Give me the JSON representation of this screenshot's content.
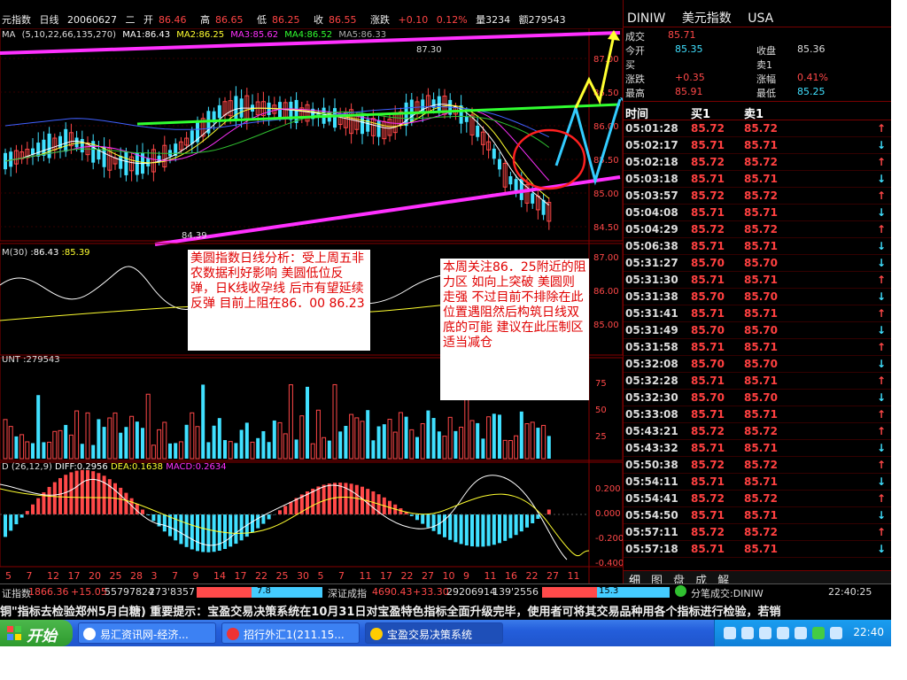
{
  "top": {
    "title": "元指数",
    "period": "日线",
    "date": "20060627",
    "weekday": "二",
    "open_label": "开",
    "open": "86.46",
    "high_label": "高",
    "high": "86.65",
    "low_label": "低",
    "low": "86.25",
    "close_label": "收",
    "close": "86.55",
    "change_label": "涨跌",
    "change": "+0.10",
    "pct": "0.12%",
    "vol": "量3234",
    "amt": "额279543"
  },
  "ma_bar": {
    "label": "MA",
    "params": "(5,10,22,66,135,270)",
    "ma1": "MA1:86.43",
    "ma2": "MA2:86.25",
    "ma3": "MA3:85.62",
    "ma4": "MA4:86.52",
    "ma5": "MA5:86.33"
  },
  "price_axis": [
    "87.00",
    "86.50",
    "86.00",
    "85.50",
    "85.00",
    "84.50"
  ],
  "hi_mark": "87.30",
  "lo_mark": "84.39",
  "dmi": {
    "label": "M",
    "params": "(30)",
    "v1": ":86.43",
    "v2": ":85.39"
  },
  "dmi_axis": [
    "87.00",
    "86.00",
    "85.00"
  ],
  "vol": {
    "label": "UNT",
    "v": "279543"
  },
  "vol_axis": [
    "75",
    "50",
    "25"
  ],
  "macd": {
    "label": "D",
    "params": "(26,12,9)",
    "diff": "DIFF:0.2956",
    "dea": "DEA:0.1638",
    "macd": "MACD:0.2634"
  },
  "macd_axis": [
    "0.200",
    "0.000",
    "-0.200",
    "-0.400"
  ],
  "x_dates": [
    "5",
    "7",
    "12",
    "17",
    "20",
    "25",
    "28",
    "3",
    "7",
    "9",
    "14",
    "17",
    "22",
    "25",
    "30",
    "5",
    "7",
    "11",
    "17",
    "22",
    "27",
    "10",
    "9",
    "11",
    "16",
    "22",
    "27",
    "11"
  ],
  "notes": {
    "left": "美圆指数日线分析：受上周五非农数据利好影响 美圆低位反弹，日K线收孕线 后市有望延续反弹  目前上阻在86．00    86.23",
    "right": "本周关注86．25附近的阻力区 如向上突破 美圆则走强 不过目前不排除在此位置遇阻然后构筑日线双底的可能 建议在此压制区适当减仓"
  },
  "right_panel": {
    "code": "DINIW",
    "name": "美元指数",
    "market": "USA",
    "stats": {
      "deal_label": "成交",
      "deal": "85.71",
      "open_label": "今开",
      "open": "85.35",
      "close_label": "收盘",
      "close": "85.36",
      "buy_label": "买",
      "sell_label": "卖1",
      "chg_label": "涨跌",
      "chg": "+0.35",
      "pct_label": "涨幅",
      "pct": "0.41%",
      "high_label": "最高",
      "high": "85.91",
      "low_label": "最低",
      "low": "85.25"
    },
    "head": {
      "time": "时间",
      "buy": "买1",
      "sell": "卖1"
    },
    "ticks": [
      {
        "t": "05:01:28",
        "b": "85.72",
        "s": "85.72",
        "d": "up"
      },
      {
        "t": "05:02:17",
        "b": "85.71",
        "s": "85.71",
        "d": "down"
      },
      {
        "t": "05:02:18",
        "b": "85.72",
        "s": "85.72",
        "d": "up"
      },
      {
        "t": "05:03:18",
        "b": "85.71",
        "s": "85.71",
        "d": "down"
      },
      {
        "t": "05:03:57",
        "b": "85.72",
        "s": "85.72",
        "d": "up"
      },
      {
        "t": "05:04:08",
        "b": "85.71",
        "s": "85.71",
        "d": "down"
      },
      {
        "t": "05:04:29",
        "b": "85.72",
        "s": "85.72",
        "d": "up"
      },
      {
        "t": "05:06:38",
        "b": "85.71",
        "s": "85.71",
        "d": "down"
      },
      {
        "t": "05:31:27",
        "b": "85.70",
        "s": "85.70",
        "d": "down"
      },
      {
        "t": "05:31:30",
        "b": "85.71",
        "s": "85.71",
        "d": "up"
      },
      {
        "t": "05:31:38",
        "b": "85.70",
        "s": "85.70",
        "d": "down"
      },
      {
        "t": "05:31:41",
        "b": "85.71",
        "s": "85.71",
        "d": "up"
      },
      {
        "t": "05:31:49",
        "b": "85.70",
        "s": "85.70",
        "d": "down"
      },
      {
        "t": "05:31:58",
        "b": "85.71",
        "s": "85.71",
        "d": "up"
      },
      {
        "t": "05:32:08",
        "b": "85.70",
        "s": "85.70",
        "d": "down"
      },
      {
        "t": "05:32:28",
        "b": "85.71",
        "s": "85.71",
        "d": "up"
      },
      {
        "t": "05:32:30",
        "b": "85.70",
        "s": "85.70",
        "d": "down"
      },
      {
        "t": "05:33:08",
        "b": "85.71",
        "s": "85.71",
        "d": "up"
      },
      {
        "t": "05:43:21",
        "b": "85.72",
        "s": "85.72",
        "d": "up"
      },
      {
        "t": "05:43:32",
        "b": "85.71",
        "s": "85.71",
        "d": "down"
      },
      {
        "t": "05:50:38",
        "b": "85.72",
        "s": "85.72",
        "d": "up"
      },
      {
        "t": "05:54:11",
        "b": "85.71",
        "s": "85.71",
        "d": "down"
      },
      {
        "t": "05:54:41",
        "b": "85.72",
        "s": "85.72",
        "d": "up"
      },
      {
        "t": "05:54:50",
        "b": "85.71",
        "s": "85.71",
        "d": "down"
      },
      {
        "t": "05:57:11",
        "b": "85.72",
        "s": "85.72",
        "d": "up"
      },
      {
        "t": "05:57:18",
        "b": "85.71",
        "s": "85.71",
        "d": "down"
      }
    ],
    "tabs": [
      "细",
      "图",
      "盘",
      "成",
      "解"
    ]
  },
  "status": {
    "sh_label": "证指数",
    "sh_val": "1866.36",
    "sh_chg": "+15.05",
    "sh_vol": "55797824",
    "sh_amt": "273'8357",
    "sh_bar": "7.8",
    "sz_label": "深证成指",
    "sz_val": "4690.43",
    "sz_chg": "+33.30",
    "sz_vol": "29206914",
    "sz_amt": "139'2556",
    "sz_bar": "15.3",
    "deal_label": "分笔成交:DINIW",
    "time": "22:40:25"
  },
  "ticker": "铜\"指标去检验郑州5月白糖)    重要提示：宝盈交易决策系统在10月31日对宝盈特色指标全面升级完毕，使用者可将其交易品种用各个指标进行检验，若销",
  "taskbar": {
    "start": "开始",
    "tasks": [
      "易汇资讯网-经济...",
      "招行外汇1(211.15...",
      "宝盈交易决策系统"
    ],
    "clock": "22:40"
  },
  "colors": {
    "up": "#ff4848",
    "down": "#40e0ff",
    "pink": "#ff30ff",
    "green": "#30ff30",
    "yellow": "#ffff30",
    "cyan_line": "#33ccff"
  }
}
